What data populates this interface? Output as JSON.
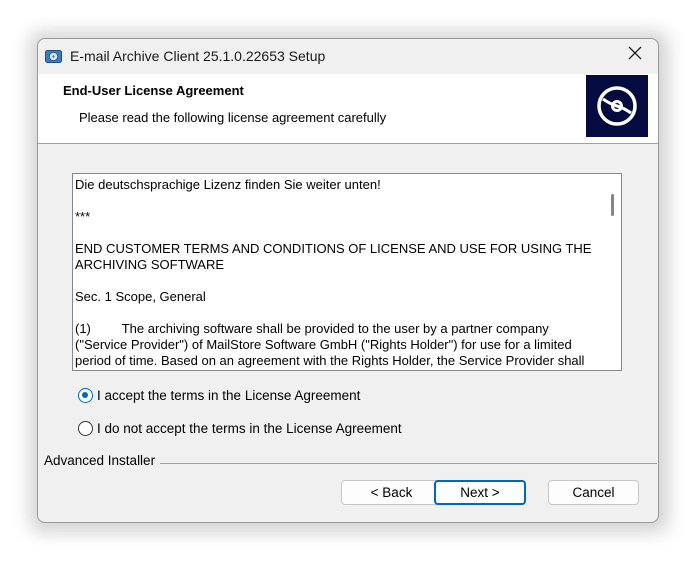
{
  "window": {
    "title": "E-mail Archive Client 25.1.0.22653 Setup",
    "close_glyph": "✕"
  },
  "banner": {
    "title": "End-User License Agreement",
    "subtitle": "Please read the following license agreement carefully"
  },
  "license": {
    "paragraphs": [
      "Die deutschsprachige Lizenz finden Sie weiter unten!",
      "***",
      "END CUSTOMER TERMS AND CONDITIONS OF LICENSE AND USE FOR USING THE ARCHIVING SOFTWARE",
      "Sec. 1 Scope, General",
      "(1)\t     The archiving software shall be provided to the user by a partner company (\"Service Provider\") of MailStore Software GmbH (\"Rights Holder\") for use for a limited period of time. Based on an agreement with the Rights Holder, the Service Provider shall"
    ]
  },
  "options": {
    "accept_label": "I accept the terms in the License Agreement",
    "decline_label": "I do not accept the terms in the License Agreement",
    "selected": "accept"
  },
  "footer": {
    "brand": "Advanced Installer",
    "back_label": "< Back",
    "next_label": "Next >",
    "cancel_label": "Cancel"
  },
  "colors": {
    "accent": "#0067c0",
    "logo_bg": "#050a40"
  },
  "icons": {
    "app": "installer-disc-icon",
    "banner": "disc-icon",
    "close": "close-icon"
  }
}
